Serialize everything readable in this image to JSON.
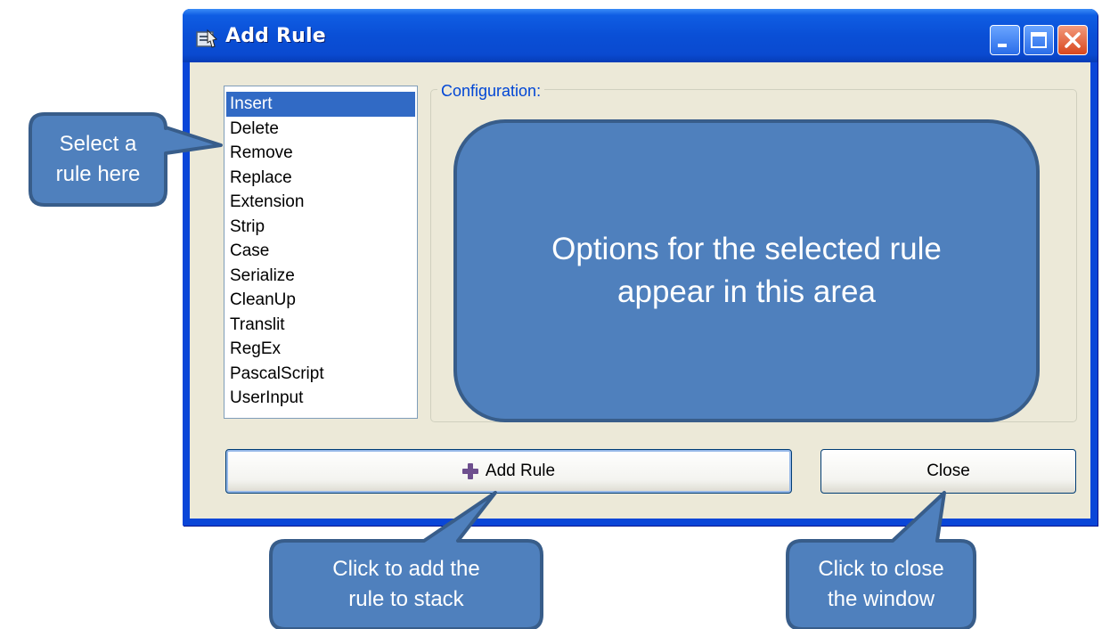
{
  "window": {
    "title": "Add Rule",
    "controls": [
      "minimize-icon",
      "maximize-icon",
      "close-icon"
    ]
  },
  "rules_list": {
    "selected": "Insert",
    "items": [
      "Insert",
      "Delete",
      "Remove",
      "Replace",
      "Extension",
      "Strip",
      "Case",
      "Serialize",
      "CleanUp",
      "Translit",
      "RegEx",
      "PascalScript",
      "UserInput"
    ]
  },
  "configuration": {
    "label": "Configuration:",
    "placeholder_text": "Options for the selected rule\nappear in this area"
  },
  "buttons": {
    "add_rule": "Add Rule",
    "close": "Close"
  },
  "callouts": {
    "select_rule": "Select a\nrule here",
    "add_rule": "Click to add  the\nrule to stack",
    "close_window": "Click to close\nthe window"
  },
  "colors": {
    "callout_fill": "#4f80bd",
    "callout_border": "#385d8a",
    "selection": "#316ac5",
    "titlebar": "#0a4fd6"
  }
}
